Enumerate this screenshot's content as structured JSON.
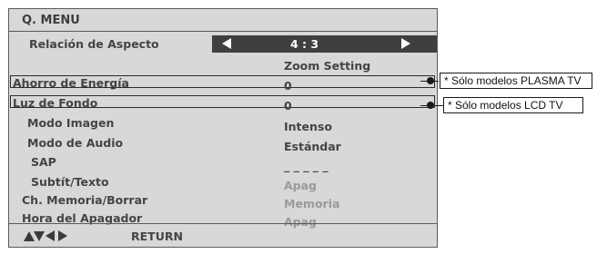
{
  "menu": {
    "title": "Q. MENU",
    "rows": [
      {
        "label": "Relación de Aspecto",
        "value": "4 : 3",
        "selected": true
      },
      {
        "label": "",
        "value": "Zoom Setting"
      },
      {
        "label": "Ahorro de Energía",
        "value": "0"
      },
      {
        "label": "Luz de Fondo",
        "value": "0"
      },
      {
        "label": "Modo Imagen",
        "value": "Intenso"
      },
      {
        "label": "Modo de Audio",
        "value": "Estándar"
      },
      {
        "label": "SAP",
        "value": "_ _ _ _ _"
      },
      {
        "label": "Subtít/Texto",
        "value": "Apag",
        "dimmed": true
      },
      {
        "label": "Ch. Memoria/Borrar",
        "value": "Memoria",
        "dimmed": true
      },
      {
        "label": "Hora del Apagador",
        "value": "Apag",
        "dimmed": true
      }
    ],
    "footer": {
      "return_label": "RETURN"
    }
  },
  "callouts": {
    "plasma": "* Sólo modelos PLASMA TV",
    "lcd": "* Sólo modelos LCD TV"
  },
  "colors": {
    "panel": "#d8d8d8",
    "selector": "#3f3f3f",
    "text": "#444444",
    "dimmed_text": "#9a9a9a"
  }
}
